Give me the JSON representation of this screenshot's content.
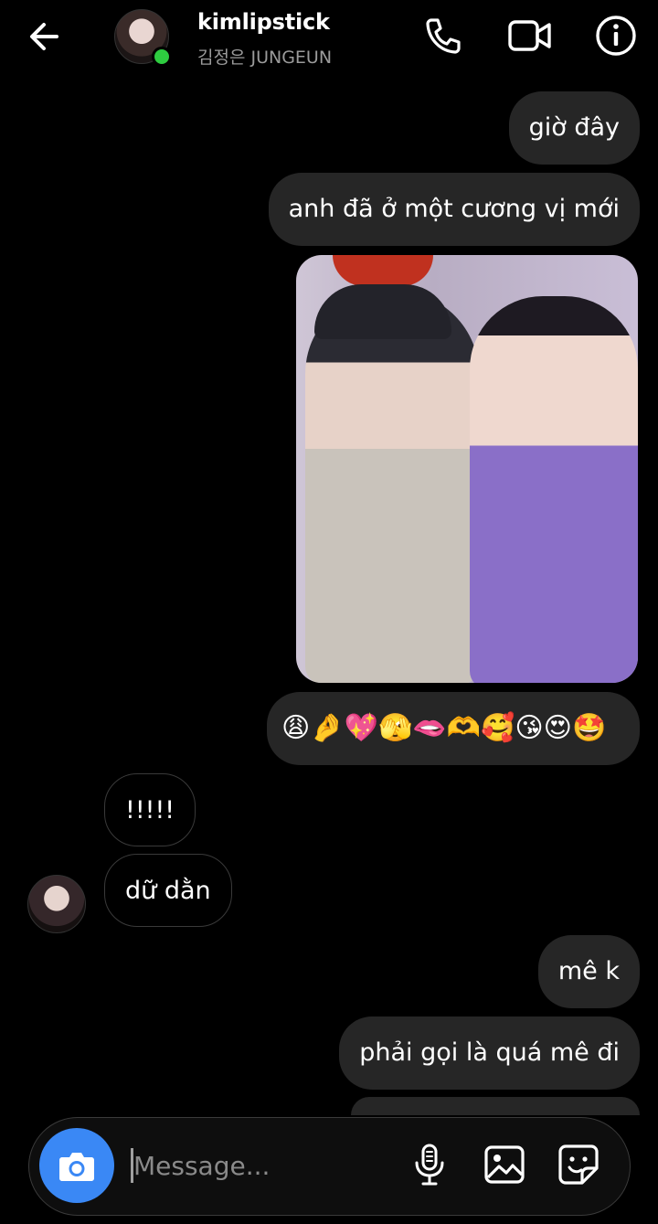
{
  "header": {
    "username": "kimlipstick",
    "subtitle": "김정은 JUNGEUN",
    "icons": [
      "back-arrow-icon",
      "phone-icon",
      "video-call-icon",
      "info-icon"
    ]
  },
  "messages": {
    "m1": "giờ đây",
    "m2": "anh đã ở một cương vị mới",
    "emoji_row": "😩🤌💖🫣🫦🫶🥰😘😍🤩",
    "m3": "!!!!!",
    "m4": "dữ dằn",
    "m5": "mê k",
    "m6": "phải gọi là quá mê đi"
  },
  "composer": {
    "placeholder": "Message...",
    "icons": [
      "camera-icon",
      "microphone-icon",
      "gallery-icon",
      "sticker-icon"
    ]
  },
  "colors": {
    "background": "#000000",
    "outgoing_bubble": "#262626",
    "online": "#2ecc40",
    "camera_button": "#3a88f5"
  }
}
